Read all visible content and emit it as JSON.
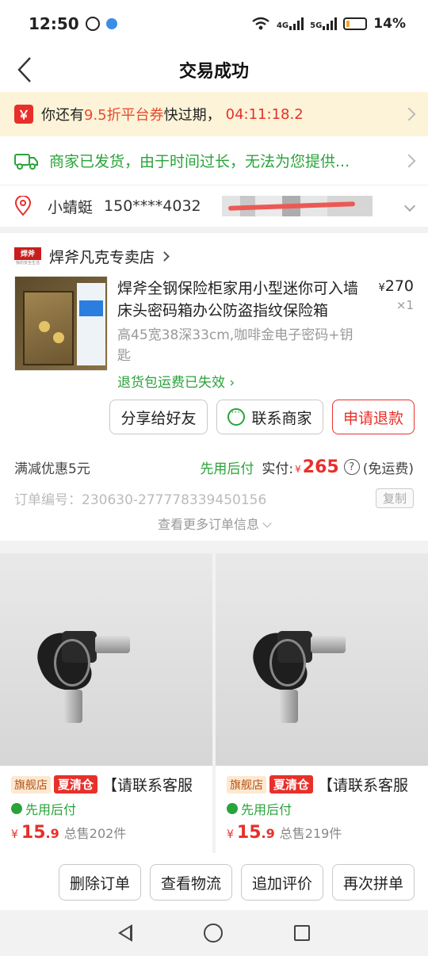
{
  "status_bar": {
    "time": "12:50",
    "battery": "14%",
    "net1": "4G",
    "net2": "5G"
  },
  "nav": {
    "title": "交易成功"
  },
  "coupon": {
    "prefix": "你还有",
    "highlight": "9.5折平台券",
    "suffix": "快过期，",
    "countdown": "04:11:18.2",
    "icon": "￥"
  },
  "shipping": {
    "text": "商家已发货，由于时间过长，无法为您提供..."
  },
  "address": {
    "name": "小蜻蜓",
    "phone": "150****4032"
  },
  "shop": {
    "name": "焊斧凡克专卖店",
    "logo_text": "焊斧",
    "logo_sub": "我的安全生活"
  },
  "product": {
    "title": "焊斧全钢保险柜家用小型迷你可入墙床头密码箱办公防盗指纹保险箱",
    "price_symbol": "¥",
    "price": "270",
    "qty": "×1",
    "spec": "高45宽38深33cm,咖啡金电子密码+钥匙",
    "return_note": "退货包运费已失效"
  },
  "actions": {
    "share": "分享给好友",
    "contact": "联系商家",
    "refund": "申请退款"
  },
  "payment": {
    "discount": "满减优惠5元",
    "pay_later": "先用后付",
    "paid_label": "实付:",
    "currency": "¥",
    "amount": "265",
    "shipping_note": "(免运费)",
    "help": "?"
  },
  "order": {
    "number": "订单编号：230630-277778339450156",
    "copy": "复制",
    "more": "查看更多订单信息"
  },
  "recommendations": [
    {
      "flag": "旗舰店",
      "sale": "夏清仓",
      "title": "【请联系客服",
      "pay_later": "先用后付",
      "currency": "¥",
      "price_int": "15",
      "price_dec": ".9",
      "sold": "总售202件"
    },
    {
      "flag": "旗舰店",
      "sale": "夏清仓",
      "title": "【请联系客服",
      "pay_later": "先用后付",
      "currency": "¥",
      "price_int": "15",
      "price_dec": ".9",
      "sold": "总售219件"
    }
  ],
  "bottom": {
    "delete": "删除订单",
    "logistics": "查看物流",
    "review": "追加评价",
    "rebuy": "再次拼单"
  },
  "colors": {
    "accent_red": "#e8302b",
    "green": "#2aa33a",
    "coupon_bg": "#fdf3d8"
  }
}
